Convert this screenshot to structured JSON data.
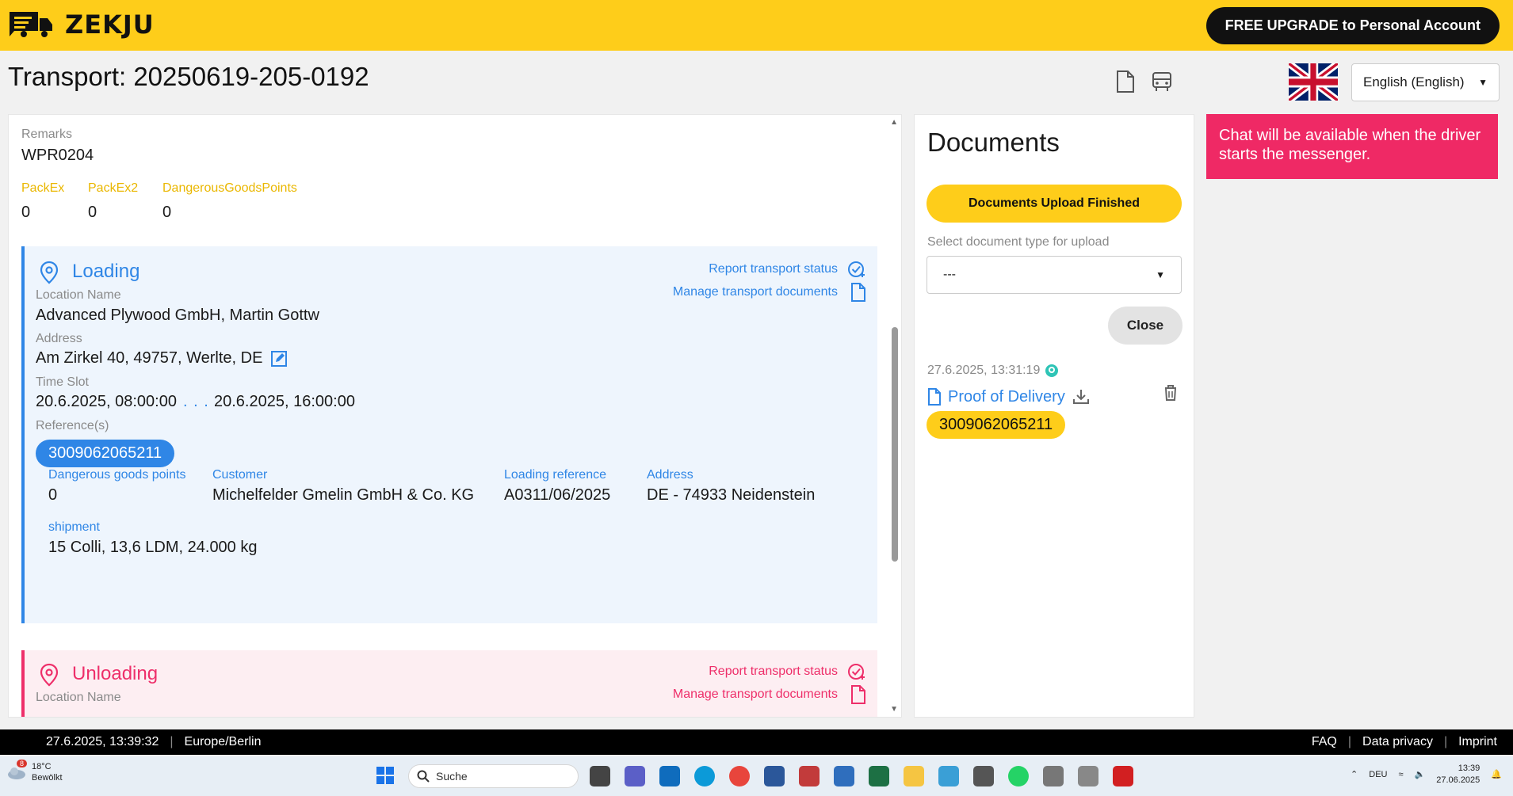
{
  "header": {
    "brand": "ZEKJU",
    "upgrade_label": "FREE UPGRADE to Personal Account"
  },
  "page": {
    "title": "Transport: 20250619-205-0192",
    "language": "English (English)"
  },
  "general": {
    "remarks_label": "Remarks",
    "remarks_value": "WPR0204",
    "packex_label": "PackEx",
    "packex_value": "0",
    "packex2_label": "PackEx2",
    "packex2_value": "0",
    "dgp_label": "DangerousGoodsPoints",
    "dgp_value": "0"
  },
  "loading": {
    "title": "Loading",
    "report_status": "Report transport status",
    "manage_docs": "Manage transport documents",
    "location_label": "Location Name",
    "location_value": "Advanced Plywood GmbH, Martin Gottw",
    "address_label": "Address",
    "address_value": "Am Zirkel 40, 49757, Werlte, DE",
    "timeslot_label": "Time Slot",
    "timeslot_from": "20.6.2025, 08:00:00",
    "timeslot_sep": ". . .",
    "timeslot_to": "20.6.2025, 16:00:00",
    "references_label": "Reference(s)",
    "reference": "3009062065211",
    "detail": {
      "dgp_label": "Dangerous goods points",
      "dgp_value": "0",
      "customer_label": "Customer",
      "customer_value": "Michelfelder Gmelin GmbH & Co. KG",
      "loadref_label": "Loading reference",
      "loadref_value": "A0311/06/2025",
      "address_label": "Address",
      "address_value": "DE - 74933 Neidenstein",
      "shipment_label": "shipment",
      "shipment_value": "15 Colli, 13,6 LDM, 24.000 kg"
    }
  },
  "unloading": {
    "title": "Unloading",
    "report_status": "Report transport status",
    "manage_docs": "Manage transport documents",
    "location_label": "Location Name"
  },
  "documents": {
    "title": "Documents",
    "upload_finished": "Documents Upload Finished",
    "select_label": "Select document type for upload",
    "select_value": "---",
    "close_label": "Close",
    "item": {
      "timestamp": "27.6.2025, 13:31:19",
      "name": "Proof of Delivery",
      "reference": "3009062065211"
    }
  },
  "chat": {
    "message": "Chat will be available when the driver starts the messenger."
  },
  "footer": {
    "datetime": "27.6.2025, 13:39:32",
    "timezone": "Europe/Berlin",
    "faq": "FAQ",
    "privacy": "Data privacy",
    "imprint": "Imprint"
  },
  "taskbar": {
    "weather_temp": "18°C",
    "weather_desc": "Bewölkt",
    "weather_badge": "8",
    "search_placeholder": "Suche",
    "lang": "DEU",
    "time": "13:39",
    "date": "27.06.2025"
  },
  "colors": {
    "brand_yellow": "#fecd1a",
    "loading_blue": "#2f86e6",
    "unloading_pink": "#ee2f6a",
    "chat_pink": "#ef2965"
  }
}
